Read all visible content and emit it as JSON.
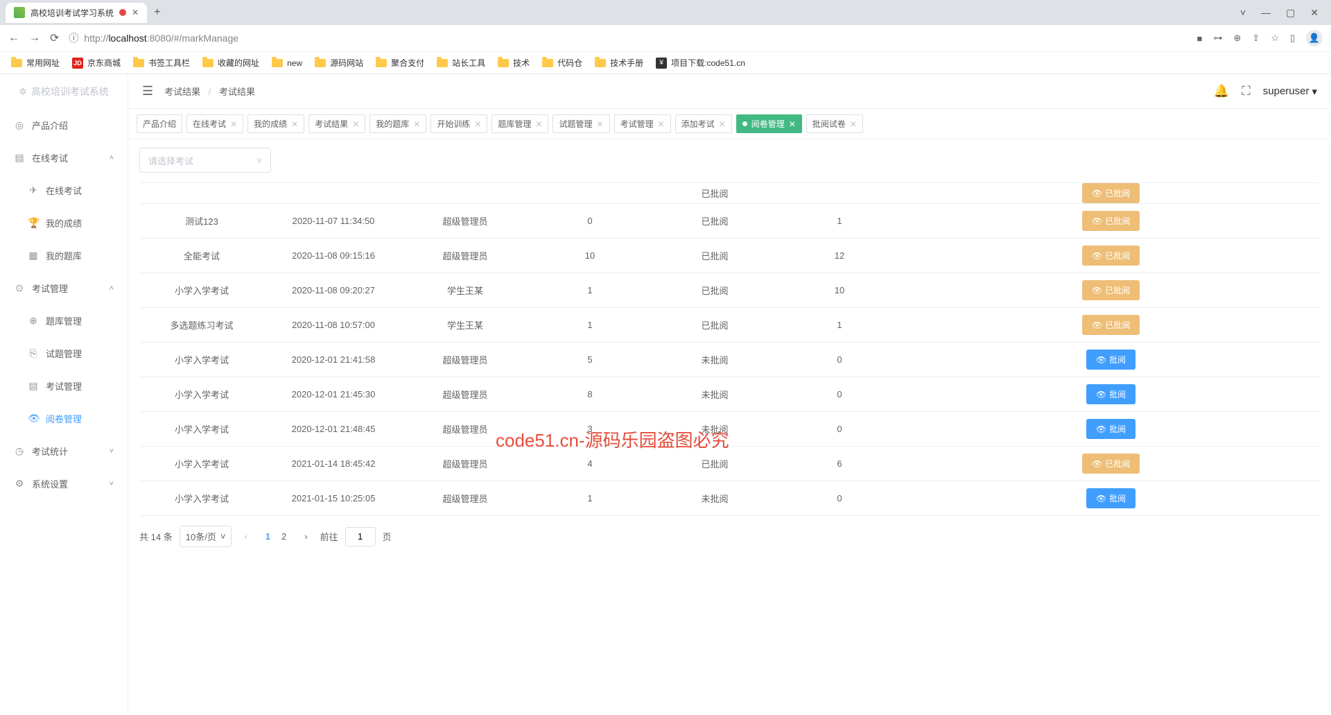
{
  "browser": {
    "tab_title": "高校培训考试学习系统",
    "url_prefix": "localhost",
    "url_port": ":8080",
    "url_path": "/#/markManage",
    "url_scheme": "http://"
  },
  "bookmarks": [
    {
      "label": "常用网址",
      "type": "folder"
    },
    {
      "label": "京东商城",
      "type": "jd"
    },
    {
      "label": "书签工具栏",
      "type": "folder"
    },
    {
      "label": "收藏的网址",
      "type": "folder"
    },
    {
      "label": "new",
      "type": "folder"
    },
    {
      "label": "源码网站",
      "type": "folder"
    },
    {
      "label": "聚合支付",
      "type": "folder"
    },
    {
      "label": "站长工具",
      "type": "folder"
    },
    {
      "label": "技术",
      "type": "folder"
    },
    {
      "label": "代码仓",
      "type": "folder"
    },
    {
      "label": "技术手册",
      "type": "folder"
    },
    {
      "label": "项目下载:code51.cn",
      "type": "dl"
    }
  ],
  "brand": "高校培训考试系统",
  "sidebar": {
    "items": [
      {
        "icon": "◎",
        "label": "产品介绍",
        "expand": ""
      },
      {
        "icon": "▤",
        "label": "在线考试",
        "expand": "˄",
        "children": [
          {
            "icon": "✈",
            "label": "在线考试"
          },
          {
            "icon": "🏆",
            "label": "我的成绩"
          },
          {
            "icon": "▦",
            "label": "我的题库"
          }
        ]
      },
      {
        "icon": "⊙",
        "label": "考试管理",
        "expand": "˄",
        "children": [
          {
            "icon": "⊕",
            "label": "题库管理"
          },
          {
            "icon": "⎘",
            "label": "试题管理"
          },
          {
            "icon": "▤",
            "label": "考试管理"
          },
          {
            "icon": "👁",
            "label": "阅卷管理",
            "active": true
          }
        ]
      },
      {
        "icon": "◷",
        "label": "考试统计",
        "expand": "˅"
      },
      {
        "icon": "⚙",
        "label": "系统设置",
        "expand": "˅"
      }
    ]
  },
  "breadcrumb": {
    "a": "考试结果",
    "b": "考试结果"
  },
  "user": "superuser",
  "tabs": [
    {
      "label": "产品介绍",
      "closable": false
    },
    {
      "label": "在线考试",
      "closable": true
    },
    {
      "label": "我的成绩",
      "closable": true
    },
    {
      "label": "考试结果",
      "closable": true
    },
    {
      "label": "我的题库",
      "closable": true
    },
    {
      "label": "开始训练",
      "closable": true
    },
    {
      "label": "题库管理",
      "closable": true
    },
    {
      "label": "试题管理",
      "closable": true
    },
    {
      "label": "考试管理",
      "closable": true
    },
    {
      "label": "添加考试",
      "closable": true
    },
    {
      "label": "阅卷管理",
      "closable": true,
      "active": true
    },
    {
      "label": "批阅试卷",
      "closable": true
    }
  ],
  "select_placeholder": "请选择考试",
  "watermark": "code51.cn-源码乐园盗图必究",
  "table": {
    "rows": [
      {
        "name": "",
        "time": "",
        "user": "",
        "c4": "",
        "status": "已批阅",
        "c6": "",
        "action": "已批阅",
        "action_type": "orange",
        "cut": true
      },
      {
        "name": "测试123",
        "time": "2020-11-07 11:34:50",
        "user": "超级管理员",
        "c4": "0",
        "status": "已批阅",
        "c6": "1",
        "action": "已批阅",
        "action_type": "orange"
      },
      {
        "name": "全能考试",
        "time": "2020-11-08 09:15:16",
        "user": "超级管理员",
        "c4": "10",
        "status": "已批阅",
        "c6": "12",
        "action": "已批阅",
        "action_type": "orange"
      },
      {
        "name": "小学入学考试",
        "time": "2020-11-08 09:20:27",
        "user": "学生王某",
        "c4": "1",
        "status": "已批阅",
        "c6": "10",
        "action": "已批阅",
        "action_type": "orange"
      },
      {
        "name": "多选题练习考试",
        "time": "2020-11-08 10:57:00",
        "user": "学生王某",
        "c4": "1",
        "status": "已批阅",
        "c6": "1",
        "action": "已批阅",
        "action_type": "orange"
      },
      {
        "name": "小学入学考试",
        "time": "2020-12-01 21:41:58",
        "user": "超级管理员",
        "c4": "5",
        "status": "未批阅",
        "c6": "0",
        "action": "批阅",
        "action_type": "primary"
      },
      {
        "name": "小学入学考试",
        "time": "2020-12-01 21:45:30",
        "user": "超级管理员",
        "c4": "8",
        "status": "未批阅",
        "c6": "0",
        "action": "批阅",
        "action_type": "primary"
      },
      {
        "name": "小学入学考试",
        "time": "2020-12-01 21:48:45",
        "user": "超级管理员",
        "c4": "3",
        "status": "未批阅",
        "c6": "0",
        "action": "批阅",
        "action_type": "primary"
      },
      {
        "name": "小学入学考试",
        "time": "2021-01-14 18:45:42",
        "user": "超级管理员",
        "c4": "4",
        "status": "已批阅",
        "c6": "6",
        "action": "已批阅",
        "action_type": "orange"
      },
      {
        "name": "小学入学考试",
        "time": "2021-01-15 10:25:05",
        "user": "超级管理员",
        "c4": "1",
        "status": "未批阅",
        "c6": "0",
        "action": "批阅",
        "action_type": "primary"
      }
    ]
  },
  "pagination": {
    "total_prefix": "共",
    "total_value": "14",
    "total_suffix": "条",
    "page_size": "10条/页",
    "pages": [
      "1",
      "2"
    ],
    "current": "1",
    "goto_prefix": "前往",
    "goto_value": "1",
    "goto_suffix": "页"
  }
}
